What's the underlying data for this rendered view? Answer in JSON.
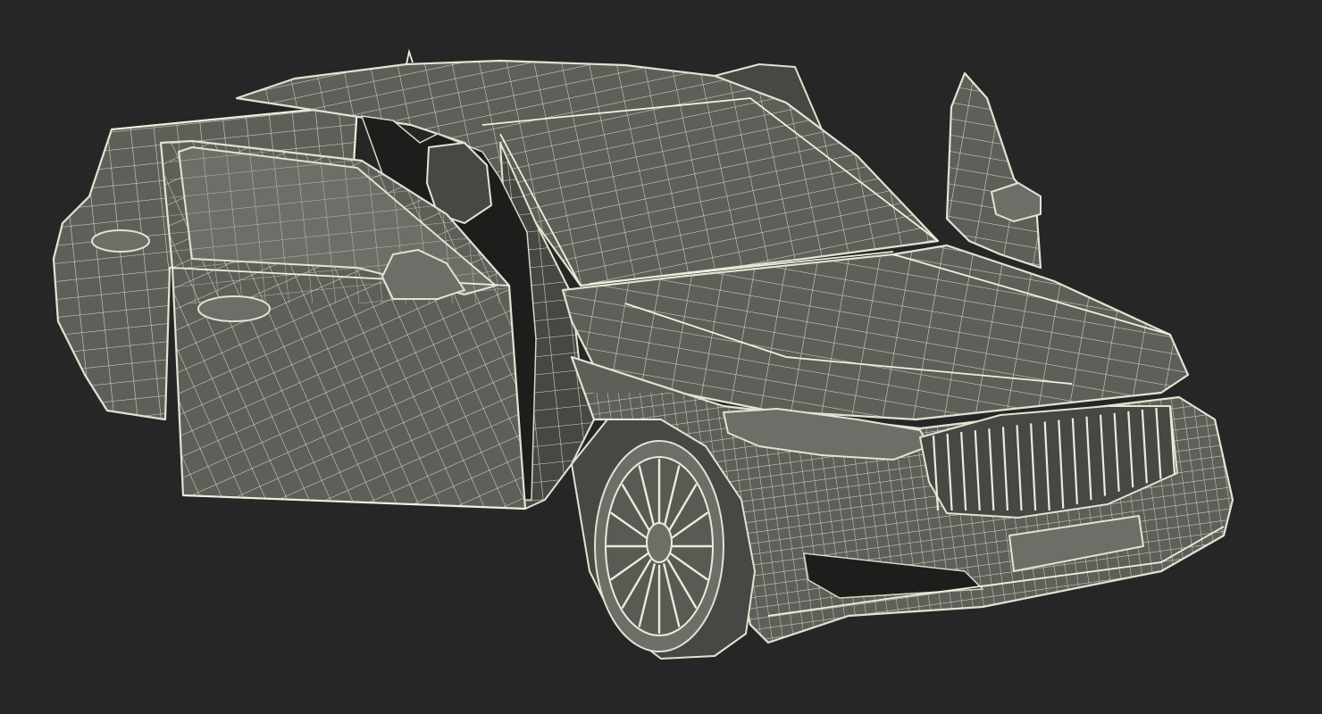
{
  "scene": {
    "subject": "wireframe-sedan",
    "background_color": "#262626",
    "shell_color": "#5f5f5a",
    "wire_color": "#e4e2d2",
    "open_doors": [
      "front-left",
      "rear-left",
      "front-right"
    ]
  }
}
